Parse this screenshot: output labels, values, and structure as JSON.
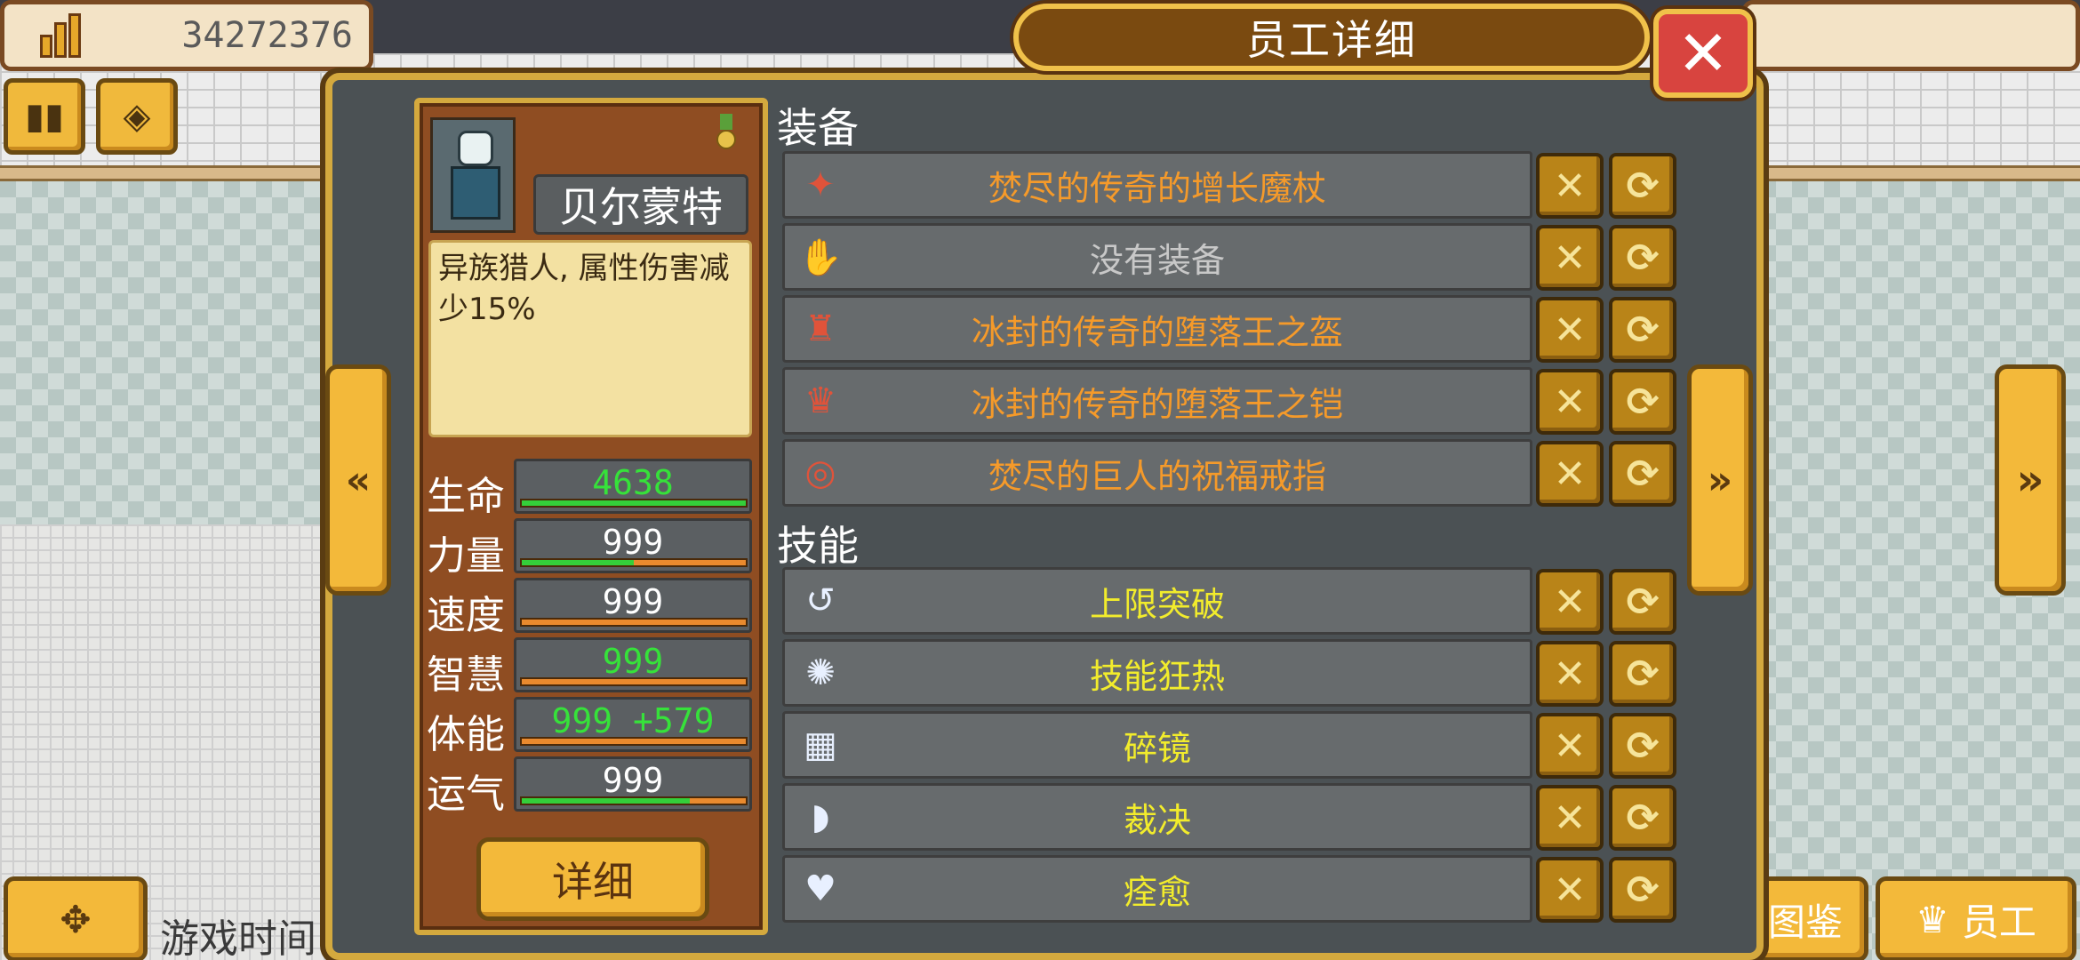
{
  "hud": {
    "money": "34272376",
    "game_time_label": "游戏时间",
    "bottom_right_buttons": [
      {
        "label": "图鉴"
      },
      {
        "label": "员工"
      }
    ]
  },
  "modal": {
    "title": "员工详细",
    "close_symbol": "✕",
    "nav_left_symbol": "«",
    "nav_right_symbol": "»"
  },
  "character": {
    "name": "贝尔蒙特",
    "trait": "异族猎人, 属性伤害减少15%",
    "stats": [
      {
        "label": "生命",
        "value": "4638",
        "highlight": true,
        "fill": 1.0
      },
      {
        "label": "力量",
        "value": "999",
        "highlight": false,
        "fill": 0.5
      },
      {
        "label": "速度",
        "value": "999",
        "highlight": false,
        "fill": 0.0
      },
      {
        "label": "智慧",
        "value": "999",
        "highlight": true,
        "fill": 0.0
      },
      {
        "label": "体能",
        "value": "999 +579",
        "highlight": true,
        "fill": 0.0
      },
      {
        "label": "运气",
        "value": "999",
        "highlight": false,
        "fill": 0.75
      }
    ],
    "detail_button": "详细"
  },
  "equipment": {
    "label": "装备",
    "items": [
      {
        "icon": "wand-icon",
        "glyph": "✦",
        "name": "焚尽的传奇的增长魔杖",
        "color": "orange"
      },
      {
        "icon": "glove-icon",
        "glyph": "✋",
        "name": "没有装备",
        "color": "gray"
      },
      {
        "icon": "helmet-icon",
        "glyph": "♜",
        "name": "冰封的传奇的堕落王之盔",
        "color": "orange"
      },
      {
        "icon": "armor-icon",
        "glyph": "♛",
        "name": "冰封的传奇的堕落王之铠",
        "color": "orange"
      },
      {
        "icon": "ring-icon",
        "glyph": "◎",
        "name": "焚尽的巨人的祝福戒指",
        "color": "orange"
      }
    ]
  },
  "skills": {
    "label": "技能",
    "items": [
      {
        "icon": "limit-break-icon",
        "glyph": "↺",
        "name": "上限突破",
        "color": "yellow"
      },
      {
        "icon": "skill-frenzy-icon",
        "glyph": "✺",
        "name": "技能狂热",
        "color": "yellow"
      },
      {
        "icon": "shattered-mirror-icon",
        "glyph": "▦",
        "name": "碎镜",
        "color": "yellow"
      },
      {
        "icon": "judgement-icon",
        "glyph": "◗",
        "name": "裁决",
        "color": "yellow"
      },
      {
        "icon": "heal-heart-icon",
        "glyph": "♥",
        "name": "痊愈",
        "color": "yellow"
      }
    ]
  },
  "row_buttons": {
    "remove_symbol": "✕",
    "swap_symbol": "⟳"
  },
  "colors": {
    "accent_gold": "#f3b93a",
    "panel_brown": "#8f4d22",
    "modal_bg": "#4b5154",
    "legendary_orange": "#f59a2a",
    "skill_yellow": "#f2ec2c",
    "stat_green": "#36e23a"
  }
}
